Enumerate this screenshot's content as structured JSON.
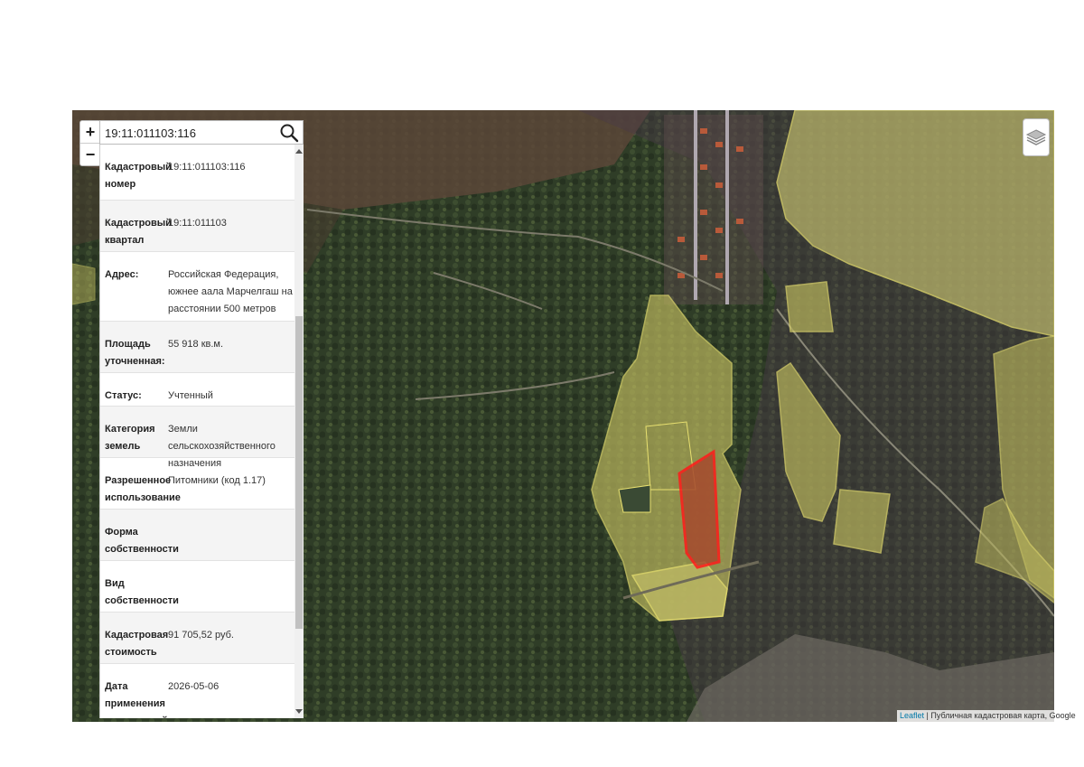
{
  "search": {
    "value": "19:11:011103:116"
  },
  "zoom": {
    "in_label": "+",
    "out_label": "−"
  },
  "info": [
    {
      "key": "Кадастровый номер",
      "value": "19:11:011103:116"
    },
    {
      "key": "Кадастровый квартал",
      "value": "19:11:011103"
    },
    {
      "key": "Адрес:",
      "value": "Российская Федерация, южнее аала Марчелгаш на расстоянии 500 метров"
    },
    {
      "key": "Площадь уточненная:",
      "value": "55 918 кв.м."
    },
    {
      "key": "Статус:",
      "value": "Учтенный"
    },
    {
      "key": "Категория земель",
      "value": "Земли сельскохозяйственного назначения"
    },
    {
      "key": "Разрешенное использование",
      "value": "Питомники (код 1.17)"
    },
    {
      "key": "Форма собственности",
      "value": ""
    },
    {
      "key": "Вид собственности",
      "value": ""
    },
    {
      "key": "Кадастровая стоимость",
      "value": "91 705,52 руб."
    },
    {
      "key": "Дата применения кадастровой",
      "value": "2026-05-06"
    }
  ],
  "attribution": {
    "link": "Leaflet",
    "text": " | Публичная кадастровая карта, Google"
  },
  "icons": {
    "search": "search-icon",
    "layers": "layers-icon"
  },
  "colors": {
    "parcel_fill": "#d8d860",
    "parcel_stroke": "#e8e070",
    "selected_stroke": "#ff1a1a"
  }
}
